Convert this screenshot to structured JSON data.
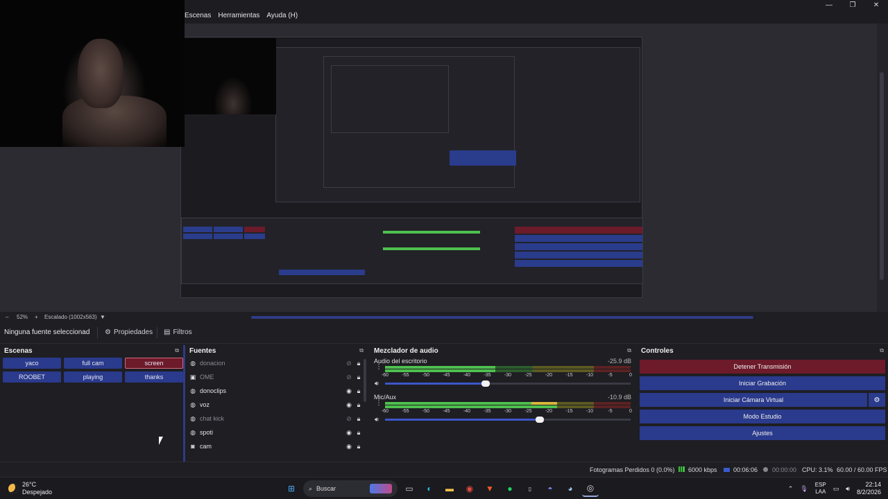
{
  "menu": {
    "items": [
      "Escenas",
      "Herramientas",
      "Ayuda (H)"
    ]
  },
  "window_controls": {
    "minimize": "—",
    "maximize": "❐",
    "close": "✕"
  },
  "zoom": {
    "percent": "52%",
    "scale_label": "Escalado (1002x563)"
  },
  "properties_bar": {
    "no_source": "Ninguna fuente seleccionad",
    "properties": "Propiedades",
    "filters": "Filtros"
  },
  "scenes": {
    "title": "Escenas",
    "items": [
      {
        "label": "yaco",
        "active": false
      },
      {
        "label": "full cam",
        "active": false
      },
      {
        "label": "screen",
        "active": true
      },
      {
        "label": "ROOBET",
        "active": false
      },
      {
        "label": "playing",
        "active": false
      },
      {
        "label": "thanks",
        "active": false
      }
    ]
  },
  "sources": {
    "title": "Fuentes",
    "items": [
      {
        "name": "donacion",
        "icon": "globe-icon",
        "visible": false
      },
      {
        "name": "OME",
        "icon": "image-icon",
        "visible": false
      },
      {
        "name": "donoclips",
        "icon": "globe-icon",
        "visible": true
      },
      {
        "name": "voz",
        "icon": "globe-icon",
        "visible": true
      },
      {
        "name": "chat kick",
        "icon": "globe-icon",
        "visible": false
      },
      {
        "name": "spoti",
        "icon": "globe-icon",
        "visible": true
      },
      {
        "name": "cam",
        "icon": "camera-icon",
        "visible": true
      }
    ]
  },
  "mixer": {
    "title": "Mezclador de audio",
    "scale": [
      "-60",
      "-55",
      "-50",
      "-45",
      "-40",
      "-35",
      "-30",
      "-25",
      "-20",
      "-15",
      "-10",
      "-5",
      "0"
    ],
    "tracks": [
      {
        "name": "Audio del escritorio",
        "db": "-25.9 dB",
        "level": 0.45,
        "volume": 0.41
      },
      {
        "name": "Mic/Aux",
        "db": "-10.9 dB",
        "level": 0.7,
        "volume": 0.63
      }
    ]
  },
  "controls": {
    "title": "Controles",
    "stop_stream": "Detener Transmisión",
    "start_recording": "Iniciar Grabación",
    "start_virtual_cam": "Iniciar Cámara Virtual",
    "studio_mode": "Modo Estudio",
    "settings": "Ajustes"
  },
  "status": {
    "dropped_frames": "Fotogramas Perdidos 0 (0.0%)",
    "bitrate": "6000 kbps",
    "stream_time": "00:06:06",
    "record_time": "00:00:00",
    "cpu": "CPU: 3.1%",
    "fps": "60.00 / 60.00 FPS"
  },
  "taskbar": {
    "weather_temp": "26°C",
    "weather_desc": "Despejado",
    "search_placeholder": "Buscar",
    "lang_top": "ESP",
    "lang_bottom": "LAA",
    "time": "22:14",
    "date": "8/2/2026"
  },
  "colors": {
    "accent_blue": "#2a3a8c",
    "active_red": "#6d1a2a",
    "meter_green": "#4ec04e"
  }
}
